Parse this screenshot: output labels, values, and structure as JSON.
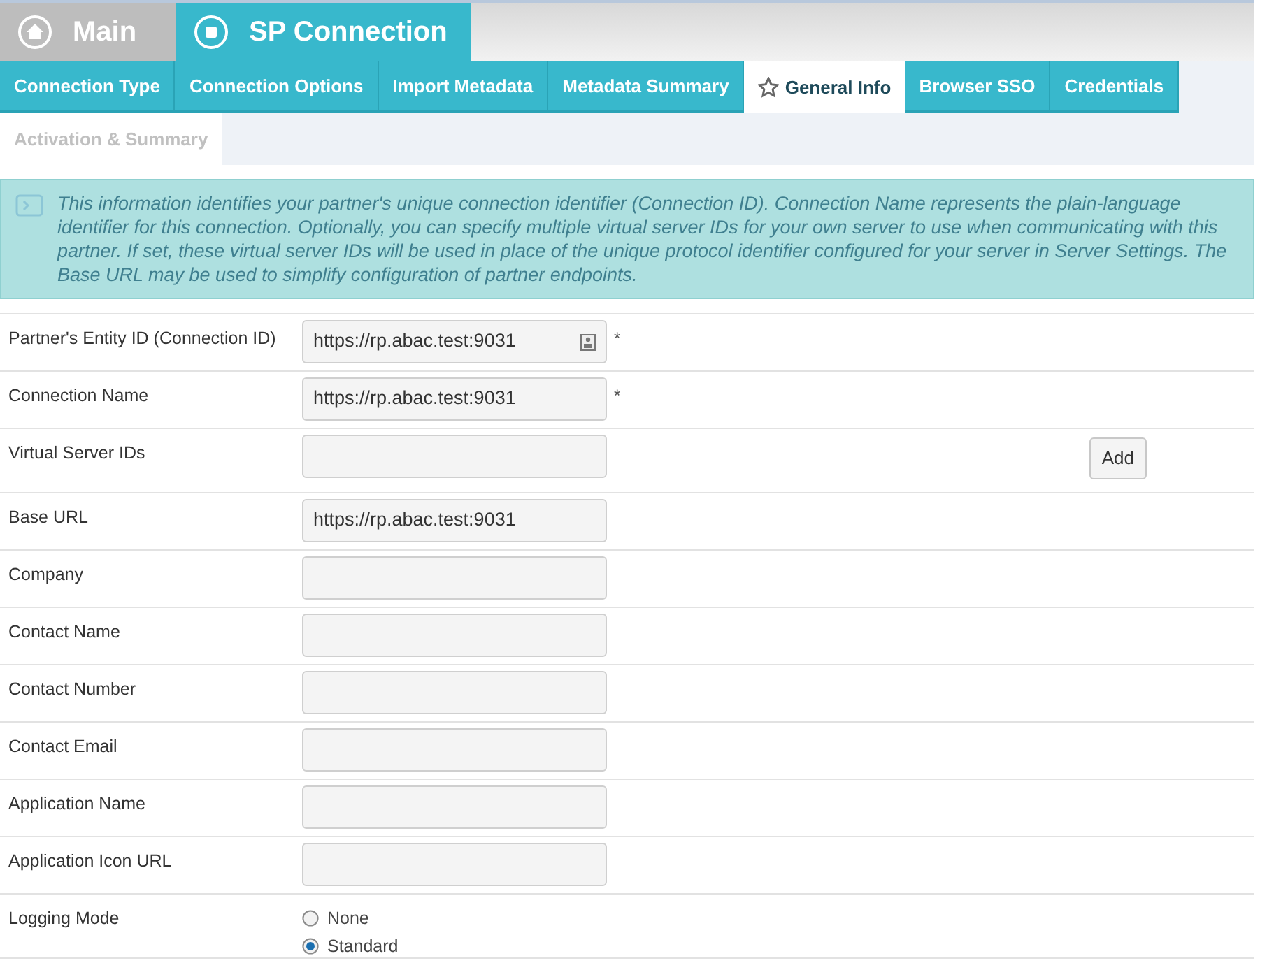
{
  "breadcrumbs": [
    {
      "label": "Main",
      "kind": "home",
      "selected": false
    },
    {
      "label": "SP Connection",
      "kind": "stop",
      "selected": true
    }
  ],
  "tabs": [
    {
      "label": "Connection Type",
      "selected": false,
      "disabled": false
    },
    {
      "label": "Connection Options",
      "selected": false,
      "disabled": false
    },
    {
      "label": "Import Metadata",
      "selected": false,
      "disabled": false
    },
    {
      "label": "Metadata Summary",
      "selected": false,
      "disabled": false
    },
    {
      "label": "General Info",
      "selected": true,
      "disabled": false
    },
    {
      "label": "Browser SSO",
      "selected": false,
      "disabled": false
    },
    {
      "label": "Credentials",
      "selected": false,
      "disabled": false
    },
    {
      "label": "Activation & Summary",
      "selected": false,
      "disabled": true
    }
  ],
  "info": "This information identifies your partner's unique connection identifier (Connection ID). Connection Name represents the plain-language identifier for this connection. Optionally, you can specify multiple virtual server IDs for your own server to use when communicating with this partner. If set, these virtual server IDs will be used in place of the unique protocol identifier configured for your server in Server Settings. The Base URL may be used to simplify configuration of partner endpoints.",
  "fields": [
    {
      "kind": "text",
      "label": "Partner's Entity ID (Connection ID)",
      "value": "https://rp.abac.test:9031",
      "required": "*",
      "contact_icon": true
    },
    {
      "kind": "text",
      "label": "Connection Name",
      "value": "https://rp.abac.test:9031",
      "required": "*"
    },
    {
      "kind": "multi",
      "label": "Virtual Server IDs",
      "button": "Add"
    },
    {
      "kind": "text",
      "label": "Base URL",
      "value": "https://rp.abac.test:9031"
    },
    {
      "kind": "text",
      "label": "Company"
    },
    {
      "kind": "text",
      "label": "Contact Name"
    },
    {
      "kind": "text",
      "label": "Contact Number"
    },
    {
      "kind": "text",
      "label": "Contact Email"
    },
    {
      "kind": "text",
      "label": "Application Name"
    },
    {
      "kind": "text",
      "label": "Application Icon URL"
    },
    {
      "kind": "radio",
      "label": "Logging Mode",
      "options": [
        {
          "label": "None",
          "selected": false
        },
        {
          "label": "Standard",
          "selected": true
        }
      ]
    }
  ]
}
